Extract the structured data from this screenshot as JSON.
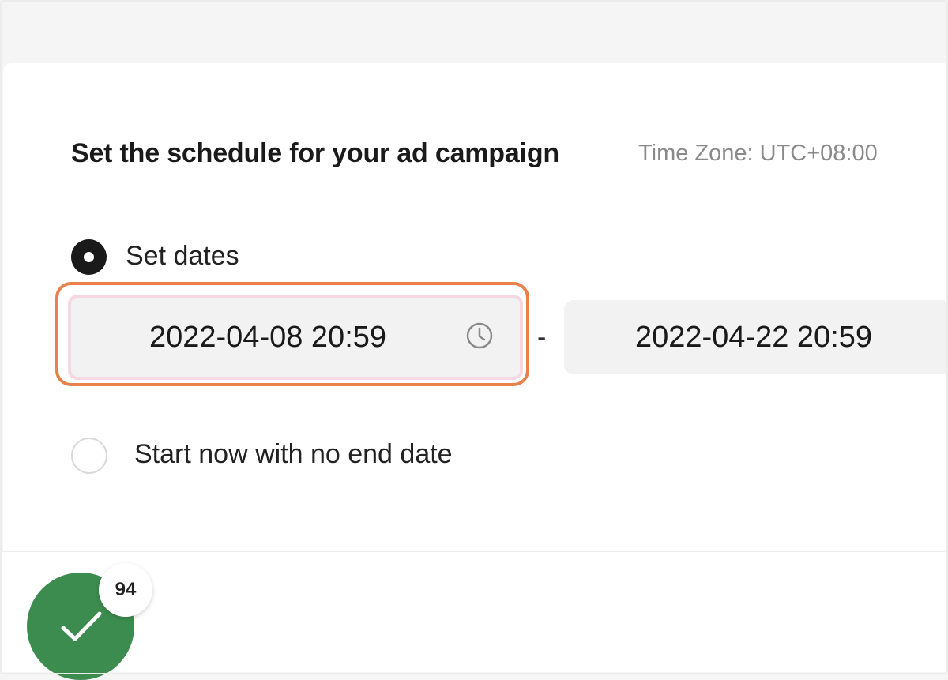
{
  "schedule": {
    "heading": "Set the schedule for your ad campaign",
    "timezone": "Time Zone: UTC+08:00"
  },
  "options": {
    "set_dates": {
      "label": "Set dates",
      "selected": true
    },
    "start_now": {
      "label": "Start now with no end date",
      "selected": false
    }
  },
  "dates": {
    "start": "2022-04-08 20:59",
    "separator": "-",
    "end": "2022-04-22 20:59",
    "start_icon": "clock-icon"
  },
  "progress_badge": {
    "count": "94",
    "icon": "check-icon",
    "color": "#3d8c4f"
  },
  "colors": {
    "focus_ring": "#e8824a",
    "input_bg": "#f2f2f2"
  }
}
